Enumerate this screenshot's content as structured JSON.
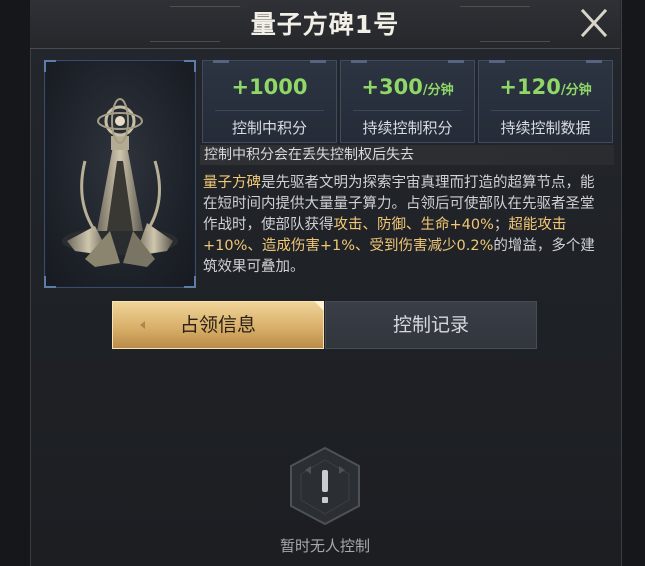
{
  "window": {
    "title": "量子方碑1号",
    "close_icon": "close-icon"
  },
  "building": {
    "image_icon": "quantum-monument-image",
    "stats": [
      {
        "value": "+1000",
        "unit": "",
        "label": "控制中积分"
      },
      {
        "value": "+300",
        "unit": "/分钟",
        "label": "持续控制积分"
      },
      {
        "value": "+120",
        "unit": "/分钟",
        "label": "持续控制数据"
      }
    ],
    "note": "控制中积分会在丢失控制权后失去",
    "description": {
      "name": "量子方碑",
      "part1": "是先驱者文明为探索宇宙真理而打造的超算节点，能在短时间内提供大量量子算力。占领后可使部队在先驱者圣堂作战时，使部队获得",
      "highlight1": "攻击、防御、生命+40%",
      "part2": "；",
      "highlight2": "超能攻击+10%、造成伤害+1%、受到伤害减少0.2%",
      "part3": "的增益，多个建筑效果可叠加。"
    }
  },
  "tabs": [
    {
      "label": "占领信息",
      "active": true
    },
    {
      "label": "控制记录",
      "active": false
    }
  ],
  "empty_state": {
    "icon": "warning-hexagon-icon",
    "text": "暂时无人控制"
  },
  "colors": {
    "value_green": "#8fd867",
    "highlight_gold": "#f0c776",
    "tab_active_gold": "#d9b06a"
  }
}
